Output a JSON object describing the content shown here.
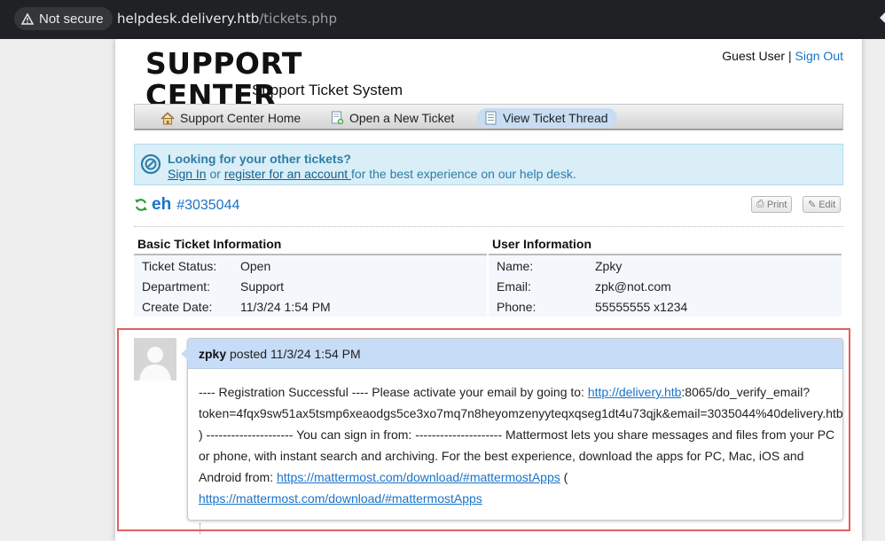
{
  "browser": {
    "security_label": "Not secure",
    "url_host": "helpdesk.delivery.htb",
    "url_path": "/tickets.php"
  },
  "header": {
    "logo_title": "SUPPORT CENTER",
    "logo_subtitle": "Support Ticket System",
    "user_label": "Guest User",
    "separator": "|",
    "signout_label": "Sign Out"
  },
  "nav": {
    "items": [
      {
        "label": "Support Center Home",
        "icon": "home-icon"
      },
      {
        "label": "Open a New Ticket",
        "icon": "new-ticket-icon"
      },
      {
        "label": "View Ticket Thread",
        "icon": "ticket-thread-icon"
      }
    ],
    "active_index": 2
  },
  "notice": {
    "title": "Looking for your other tickets?",
    "signin_label": "Sign In",
    "or_text": " or ",
    "register_label": "register for an account ",
    "suffix": "for the best experience on our help desk."
  },
  "ticket": {
    "title": "eh",
    "number": "#3035044",
    "print_label": "Print",
    "edit_label": "Edit"
  },
  "basic_info": {
    "heading": "Basic Ticket Information",
    "rows": [
      {
        "label": "Ticket Status:",
        "value": "Open"
      },
      {
        "label": "Department:",
        "value": "Support"
      },
      {
        "label": "Create Date:",
        "value": "11/3/24 1:54 PM"
      }
    ]
  },
  "user_info": {
    "heading": "User Information",
    "rows": [
      {
        "label": "Name:",
        "value": "Zpky"
      },
      {
        "label": "Email:",
        "value": "zpk@not.com"
      },
      {
        "label": "Phone:",
        "value": "55555555 x1234"
      }
    ]
  },
  "thread": {
    "author": "zpky",
    "posted_text": " posted 11/3/24 1:54 PM",
    "body_1": "---- Registration Successful ---- Please activate your email by going to: ",
    "link_1": "http://delivery.htb",
    "body_2": ":8065/do_verify_email?token=4fqx9sw51ax5tsmp6xeaodgs5ce3xo7mq7n8heyomzenyyteqxqseg1dt4u73qjk&email=3035044%40delivery.htb ) --------------------- You can sign in from: --------------------- Mattermost lets you share messages and files from your PC or phone, with instant search and archiving. For the best experience, download the apps for PC, Mac, iOS and Android from: ",
    "link_2": "https://mattermost.com/download/#mattermostApps",
    "body_3": " (",
    "link_3": "https://mattermost.com/download/#mattermostApps"
  }
}
